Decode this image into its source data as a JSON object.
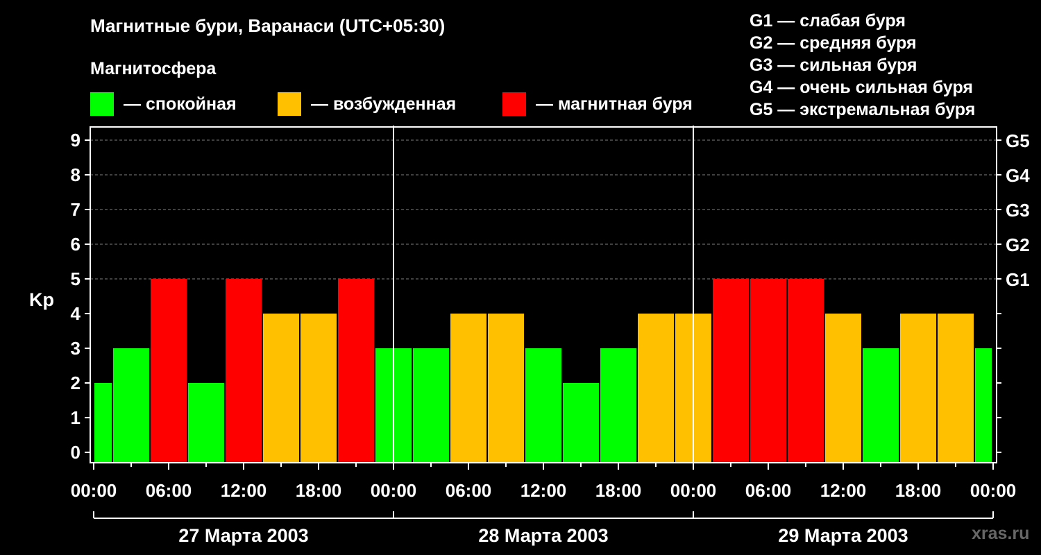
{
  "title": "Магнитные бури, Варанаси (UTC+05:30)",
  "subtitle": "Магнитосфера",
  "legend": [
    {
      "label": "— спокойная",
      "color": "#00ff00"
    },
    {
      "label": "— возбужденная",
      "color": "#ffc000"
    },
    {
      "label": "— магнитная буря",
      "color": "#ff0000"
    }
  ],
  "g_levels": [
    "G1 — слабая буря",
    "G2 — средняя буря",
    "G3 — сильная буря",
    "G4 — очень сильная буря",
    "G5 — экстремальная буря"
  ],
  "watermark": "xras.ru",
  "colors": {
    "quiet": "#00ff00",
    "active": "#ffc000",
    "storm": "#ff0000",
    "background": "#000000",
    "axis": "#ffffff"
  },
  "chart_data": {
    "type": "bar",
    "ylabel": "Kp",
    "ylim": [
      0,
      9
    ],
    "yticks": [
      "0",
      "1",
      "2",
      "3",
      "4",
      "5",
      "6",
      "7",
      "8",
      "9"
    ],
    "right_ticks": [
      {
        "kp": 5,
        "label": "G1"
      },
      {
        "kp": 6,
        "label": "G2"
      },
      {
        "kp": 7,
        "label": "G3"
      },
      {
        "kp": 8,
        "label": "G4"
      },
      {
        "kp": 9,
        "label": "G5"
      }
    ],
    "grid": true,
    "x_tick_labels": [
      "00:00",
      "06:00",
      "12:00",
      "18:00",
      "00:00",
      "06:00",
      "12:00",
      "18:00",
      "00:00",
      "06:00",
      "12:00",
      "18:00",
      "00:00"
    ],
    "days": [
      "27 Марта 2003",
      "28 Марта 2003",
      "29 Марта 2003"
    ],
    "bars": [
      {
        "day": 0,
        "start_hour": 0.0,
        "end_hour": 1.5,
        "kp": 2
      },
      {
        "day": 0,
        "start_hour": 1.5,
        "end_hour": 4.5,
        "kp": 3
      },
      {
        "day": 0,
        "start_hour": 4.5,
        "end_hour": 7.5,
        "kp": 5
      },
      {
        "day": 0,
        "start_hour": 7.5,
        "end_hour": 10.5,
        "kp": 2
      },
      {
        "day": 0,
        "start_hour": 10.5,
        "end_hour": 13.5,
        "kp": 5
      },
      {
        "day": 0,
        "start_hour": 13.5,
        "end_hour": 16.5,
        "kp": 4
      },
      {
        "day": 0,
        "start_hour": 16.5,
        "end_hour": 19.5,
        "kp": 4
      },
      {
        "day": 0,
        "start_hour": 19.5,
        "end_hour": 22.5,
        "kp": 5
      },
      {
        "day": 0,
        "start_hour": 22.5,
        "end_hour": 25.5,
        "kp": 3
      },
      {
        "day": 1,
        "start_hour": 1.5,
        "end_hour": 4.5,
        "kp": 3
      },
      {
        "day": 1,
        "start_hour": 4.5,
        "end_hour": 7.5,
        "kp": 4
      },
      {
        "day": 1,
        "start_hour": 7.5,
        "end_hour": 10.5,
        "kp": 4
      },
      {
        "day": 1,
        "start_hour": 10.5,
        "end_hour": 13.5,
        "kp": 3
      },
      {
        "day": 1,
        "start_hour": 13.5,
        "end_hour": 16.5,
        "kp": 2
      },
      {
        "day": 1,
        "start_hour": 16.5,
        "end_hour": 19.5,
        "kp": 3
      },
      {
        "day": 1,
        "start_hour": 19.5,
        "end_hour": 22.5,
        "kp": 4
      },
      {
        "day": 1,
        "start_hour": 22.5,
        "end_hour": 25.5,
        "kp": 4
      },
      {
        "day": 2,
        "start_hour": 1.5,
        "end_hour": 4.5,
        "kp": 5
      },
      {
        "day": 2,
        "start_hour": 4.5,
        "end_hour": 7.5,
        "kp": 5
      },
      {
        "day": 2,
        "start_hour": 7.5,
        "end_hour": 10.5,
        "kp": 5
      },
      {
        "day": 2,
        "start_hour": 10.5,
        "end_hour": 13.5,
        "kp": 4
      },
      {
        "day": 2,
        "start_hour": 13.5,
        "end_hour": 16.5,
        "kp": 3
      },
      {
        "day": 2,
        "start_hour": 16.5,
        "end_hour": 19.5,
        "kp": 4
      },
      {
        "day": 2,
        "start_hour": 19.5,
        "end_hour": 22.5,
        "kp": 4
      },
      {
        "day": 2,
        "start_hour": 22.5,
        "end_hour": 24.0,
        "kp": 3
      }
    ]
  }
}
